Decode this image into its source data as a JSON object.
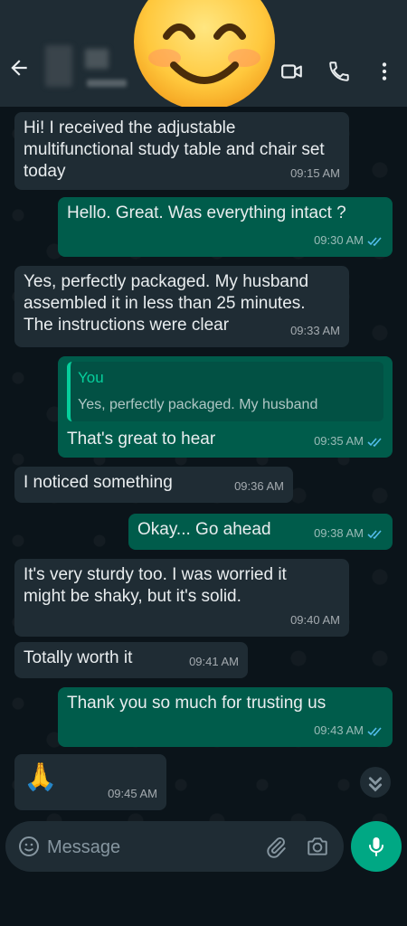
{
  "colors": {
    "header_bg": "#1f2c34",
    "chat_bg": "#0b141a",
    "incoming_bubble": "#1f2c34",
    "outgoing_bubble": "#005c4b",
    "accent": "#00a884",
    "read_ticks": "#53bdeb"
  },
  "header": {
    "back_icon": "arrow-left-icon",
    "icons": [
      "video-call-icon",
      "phone-icon",
      "more-vert-icon"
    ],
    "overlay_emoji": "smiling-face-icon"
  },
  "messages": [
    {
      "dir": "in",
      "text": "Hi! I received the adjustable multifunctional study table and chair set today",
      "time": "09:15 AM"
    },
    {
      "dir": "out",
      "text": "Hello. Great. Was everything intact ?",
      "time": "09:30 AM"
    },
    {
      "dir": "in",
      "text": "Yes, perfectly packaged. My husband assembled it in less than 25 minutes. The instructions were clear",
      "time": "09:33 AM"
    },
    {
      "dir": "out",
      "quote_author": "You",
      "quote_text": "Yes, perfectly packaged. My husband",
      "text": "That's great to hear",
      "time": "09:35 AM"
    },
    {
      "dir": "in",
      "text": "I noticed something",
      "time": "09:36 AM"
    },
    {
      "dir": "out",
      "text": "Okay... Go ahead",
      "time": "09:38 AM"
    },
    {
      "dir": "in",
      "text": "It's very sturdy too. I was worried it might be shaky, but it's solid.",
      "time": "09:40 AM"
    },
    {
      "dir": "in",
      "text": "Totally worth it",
      "time": "09:41 AM"
    },
    {
      "dir": "out",
      "text": "Thank you so much for trusting us",
      "time": "09:43 AM"
    },
    {
      "dir": "in",
      "text": "🙏",
      "time": "09:45 AM"
    }
  ],
  "input": {
    "placeholder": "Message"
  }
}
